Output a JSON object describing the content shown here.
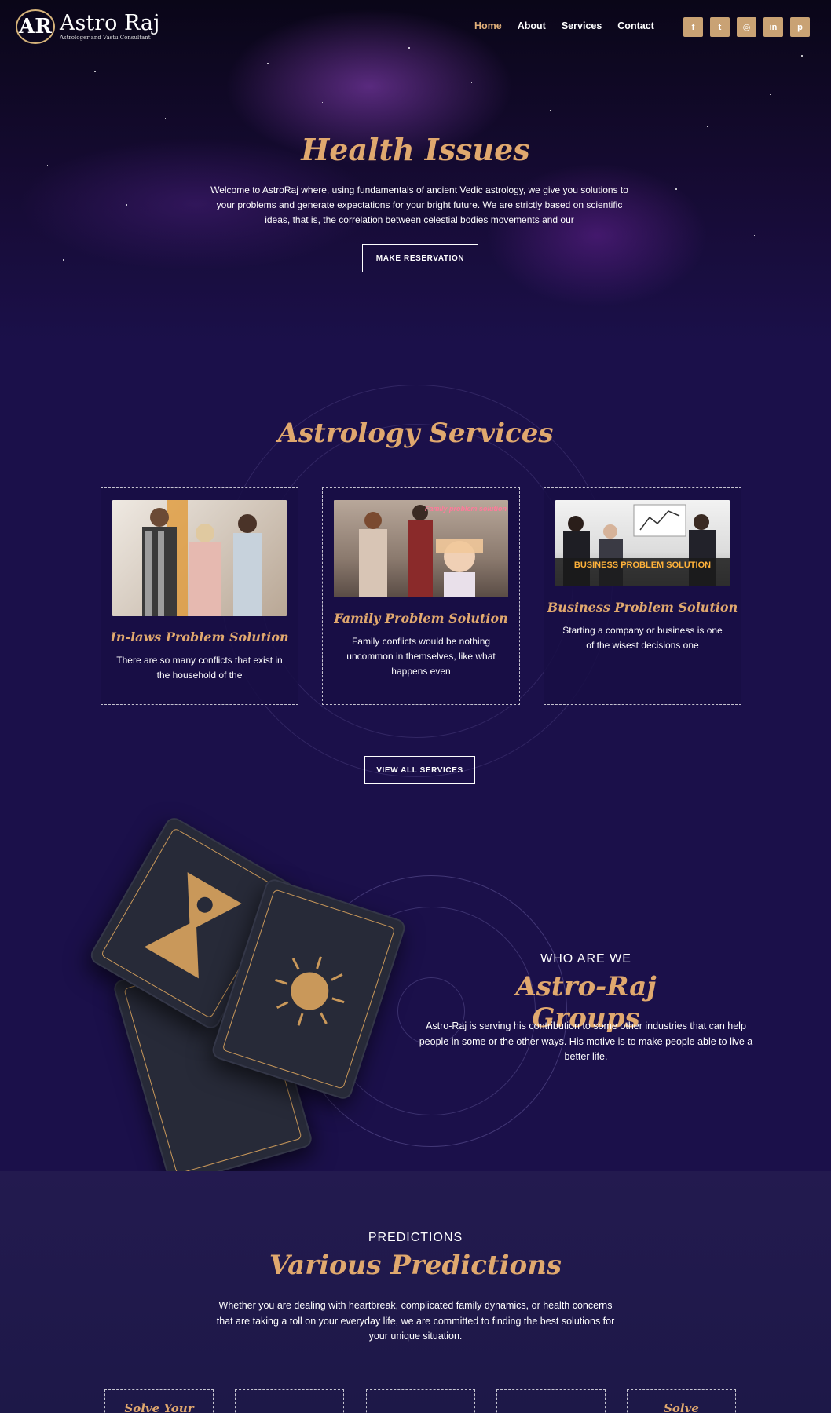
{
  "brand": {
    "logo_mark": "AR",
    "name": "Astro Raj",
    "tagline": "Astrologer and Vastu Consultant"
  },
  "nav": {
    "items": [
      {
        "label": "Home",
        "active": true
      },
      {
        "label": "About",
        "active": false
      },
      {
        "label": "Services",
        "active": false
      },
      {
        "label": "Contact",
        "active": false
      }
    ]
  },
  "socials": [
    {
      "icon": "facebook-icon",
      "glyph": "f"
    },
    {
      "icon": "twitter-icon",
      "glyph": "t"
    },
    {
      "icon": "instagram-icon",
      "glyph": "◎"
    },
    {
      "icon": "linkedin-icon",
      "glyph": "in"
    },
    {
      "icon": "pinterest-icon",
      "glyph": "p"
    }
  ],
  "hero": {
    "title": "Health Issues",
    "text": "Welcome to AstroRaj where, using fundamentals of ancient Vedic astrology, we give you solutions to your problems and generate expectations for your bright future. We are strictly based on scientific ideas, that is, the correlation between celestial bodies movements and our",
    "button": "MAKE RESERVATION"
  },
  "services": {
    "title": "Astrology Services",
    "cards": [
      {
        "title": "In-laws Problem Solution",
        "text": "There are so many conflicts that exist in the household of the",
        "image_caption": ""
      },
      {
        "title": "Family Problem Solution",
        "text": "Family conflicts would be nothing uncommon in themselves, like what happens even",
        "image_caption": "Family problem solution"
      },
      {
        "title": "Business Problem Solution",
        "text": "Starting a company or business is one of the wisest decisions one",
        "image_caption": "BUSINESS PROBLEM SOLUTION"
      }
    ],
    "button": "VIEW ALL SERVICES"
  },
  "who": {
    "kicker": "WHO ARE WE",
    "title": "Astro-Raj Groups",
    "text": "Astro-Raj is serving his contribution to some other industries that can help people in some or the other ways. His motive is to make people able to live a better life."
  },
  "predictions": {
    "kicker": "PREDICTIONS",
    "title": "Various Predictions",
    "text": "Whether you are dealing with heartbreak, complicated family dynamics, or health concerns that are taking a toll on your everyday life, we are committed to finding the best solutions for your unique situation.",
    "cards": [
      {
        "title": "Solve Your"
      },
      {
        "title": ""
      },
      {
        "title": ""
      },
      {
        "title": ""
      },
      {
        "title": "Solve"
      }
    ]
  },
  "colors": {
    "accent": "#e0a86e",
    "background": "#1b104a",
    "social_bg": "#c9a274"
  }
}
